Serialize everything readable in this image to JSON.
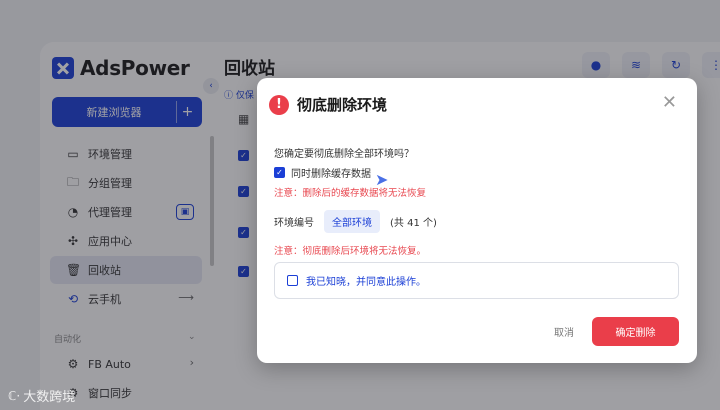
{
  "app": {
    "logo_text": "AdsPower",
    "new_browser_label": "新建浏览器",
    "new_browser_plus": "+",
    "collapse_glyph": "‹"
  },
  "sidebar": {
    "items": [
      {
        "label": "环境管理",
        "icon": "window-icon"
      },
      {
        "label": "分组管理",
        "icon": "folder-icon"
      },
      {
        "label": "代理管理",
        "icon": "proxy-icon"
      },
      {
        "label": "应用中心",
        "icon": "puzzle-icon"
      },
      {
        "label": "回收站",
        "icon": "trash-icon"
      },
      {
        "label": "云手机",
        "icon": "sync-icon"
      }
    ],
    "section_label": "自动化",
    "auto_items": [
      {
        "label": "FB Auto",
        "icon": "gear-icon"
      },
      {
        "label": "窗口同步",
        "icon": "gear-icon"
      }
    ]
  },
  "main": {
    "title": "回收站",
    "notice": "仅保"
  },
  "dialog": {
    "title": "彻底删除环境",
    "question": "您确定要彻底删除全部环境吗？",
    "clear_cache_label": "同时删除缓存数据",
    "cache_warning": "注意：删除后的缓存数据将无法恢复",
    "env_label": "环境编号",
    "env_tag": "全部环境",
    "env_count": "(共 41 个)",
    "delete_warning": "注意：彻底删除后环境将无法恢复。",
    "confirm_label": "我已知晓，并同意此操作。",
    "cancel_label": "取消",
    "delete_label": "确定删除"
  },
  "watermark": "大数跨境",
  "colors": {
    "brand": "#1b3fd6",
    "danger": "#ea3e4a"
  }
}
